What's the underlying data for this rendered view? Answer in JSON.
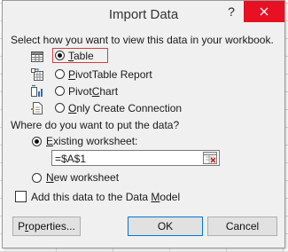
{
  "window": {
    "title": "Import Data"
  },
  "titlebar": {
    "help_glyph": "?",
    "close_icon": "close-icon"
  },
  "view_section": {
    "heading": "Select how you want to view this data in your workbook.",
    "options": [
      {
        "id": "table",
        "label": "Table",
        "underline": "T",
        "rest": "able",
        "selected": true,
        "icon": "table-icon"
      },
      {
        "id": "pivottable",
        "label": "PivotTable Report",
        "underline": "P",
        "rest": "ivotTable Report",
        "selected": false,
        "icon": "pivottable-icon"
      },
      {
        "id": "pivotchart",
        "label": "PivotChart",
        "pre": "Pivot",
        "underline": "C",
        "rest": "hart",
        "selected": false,
        "icon": "pivotchart-icon"
      },
      {
        "id": "connection",
        "label": "Only Create Connection",
        "underline": "O",
        "rest": "nly Create Connection",
        "selected": false,
        "icon": "connection-icon"
      }
    ]
  },
  "location_section": {
    "heading": "Where do you want to put the data?",
    "existing": {
      "label": "Existing worksheet:",
      "underline": "E",
      "rest": "xisting worksheet:",
      "selected": true
    },
    "reference_value": "=$A$1",
    "new": {
      "label": "New worksheet",
      "underline": "N",
      "rest": "ew worksheet",
      "selected": false
    }
  },
  "data_model": {
    "label": "Add this data to the Data Model",
    "underline": "M",
    "pre": "Add this data to the Data ",
    "rest": "odel",
    "checked": false
  },
  "buttons": {
    "properties": {
      "label": "Properties...",
      "pre": "P",
      "underline": "r",
      "rest": "operties..."
    },
    "ok": "OK",
    "cancel": "Cancel"
  },
  "colors": {
    "close_button": "#e81123",
    "focus_border": "#d04040",
    "default_button_border": "#0078d7"
  }
}
